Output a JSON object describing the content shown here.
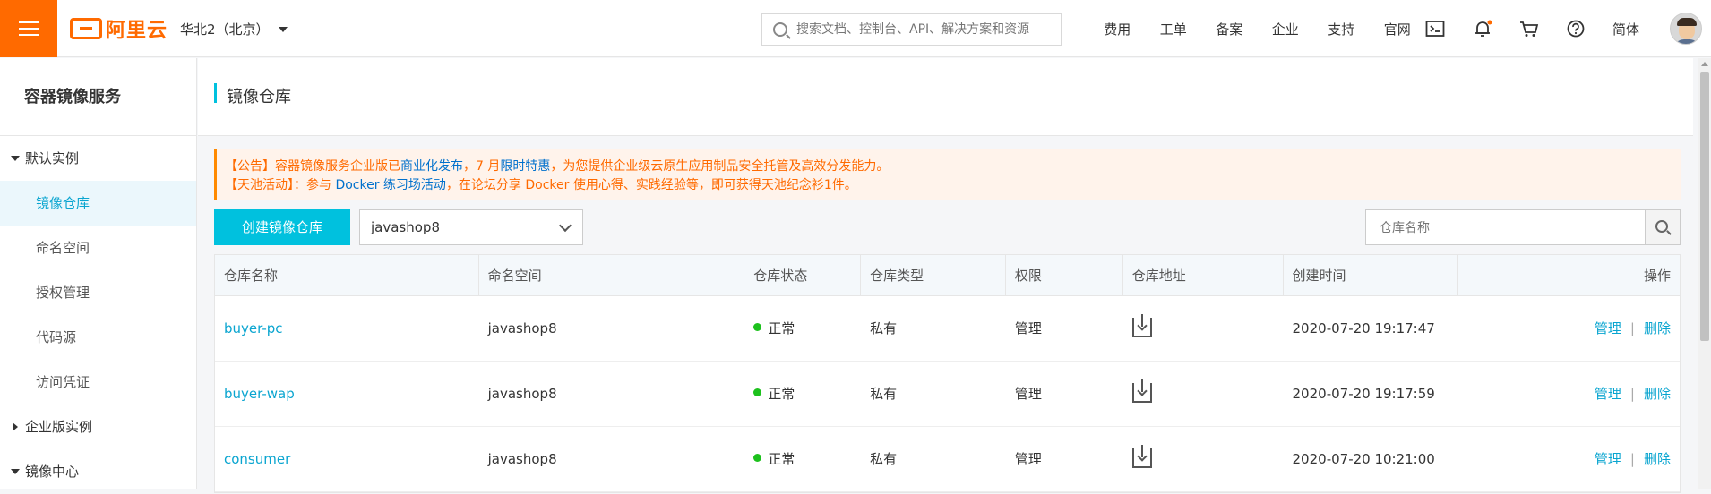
{
  "header": {
    "logo_text": "阿里云",
    "region": "华北2（北京）",
    "search_placeholder": "搜索文档、控制台、API、解决方案和资源",
    "links": [
      "费用",
      "工单",
      "备案",
      "企业",
      "支持",
      "官网"
    ],
    "icons": [
      "terminal-icon",
      "bell-icon",
      "cart-icon",
      "help-icon"
    ],
    "language": "简体",
    "accent_color": "#ff6a00"
  },
  "sidebar": {
    "title": "容器镜像服务",
    "groups": [
      {
        "label": "默认实例",
        "expanded": true
      },
      {
        "label": "企业版实例",
        "expanded": false
      },
      {
        "label": "镜像中心",
        "expanded": true
      }
    ],
    "items": [
      "镜像仓库",
      "命名空间",
      "授权管理",
      "代码源",
      "访问凭证"
    ],
    "active_item": "镜像仓库"
  },
  "page": {
    "title": "镜像仓库",
    "notice": {
      "line1_a": "【公告】容器镜像服务企业版已",
      "line1_link1": "商业化发布",
      "line1_b": "，7 月",
      "line1_link2": "限时特惠",
      "line1_c": "，为您提供企业级云原生应用制品安全托管及高效分发能力。",
      "line2_a": "【天池活动】：参与 ",
      "line2_link": "Docker 练习场活动",
      "line2_b": "，在论坛分享 Docker 使用心得、实践经验等，即可获得天池纪念衫1件。"
    },
    "create_button": "创建镜像仓库",
    "namespace_select": "javashop8",
    "repo_search_placeholder": "仓库名称"
  },
  "table": {
    "headers": [
      "仓库名称",
      "命名空间",
      "仓库状态",
      "仓库类型",
      "权限",
      "仓库地址",
      "创建时间",
      "操作"
    ],
    "rows": [
      {
        "name": "buyer-pc",
        "namespace": "javashop8",
        "status": "正常",
        "type": "私有",
        "permission": "管理",
        "created": "2020-07-20 19:17:47",
        "op_manage": "管理",
        "op_delete": "删除"
      },
      {
        "name": "buyer-wap",
        "namespace": "javashop8",
        "status": "正常",
        "type": "私有",
        "permission": "管理",
        "created": "2020-07-20 19:17:59",
        "op_manage": "管理",
        "op_delete": "删除"
      },
      {
        "name": "consumer",
        "namespace": "javashop8",
        "status": "正常",
        "type": "私有",
        "permission": "管理",
        "created": "2020-07-20 10:21:00",
        "op_manage": "管理",
        "op_delete": "删除"
      }
    ],
    "op_separator": "|",
    "status_color": "#1dc11d",
    "link_color": "#0aa5d0"
  }
}
